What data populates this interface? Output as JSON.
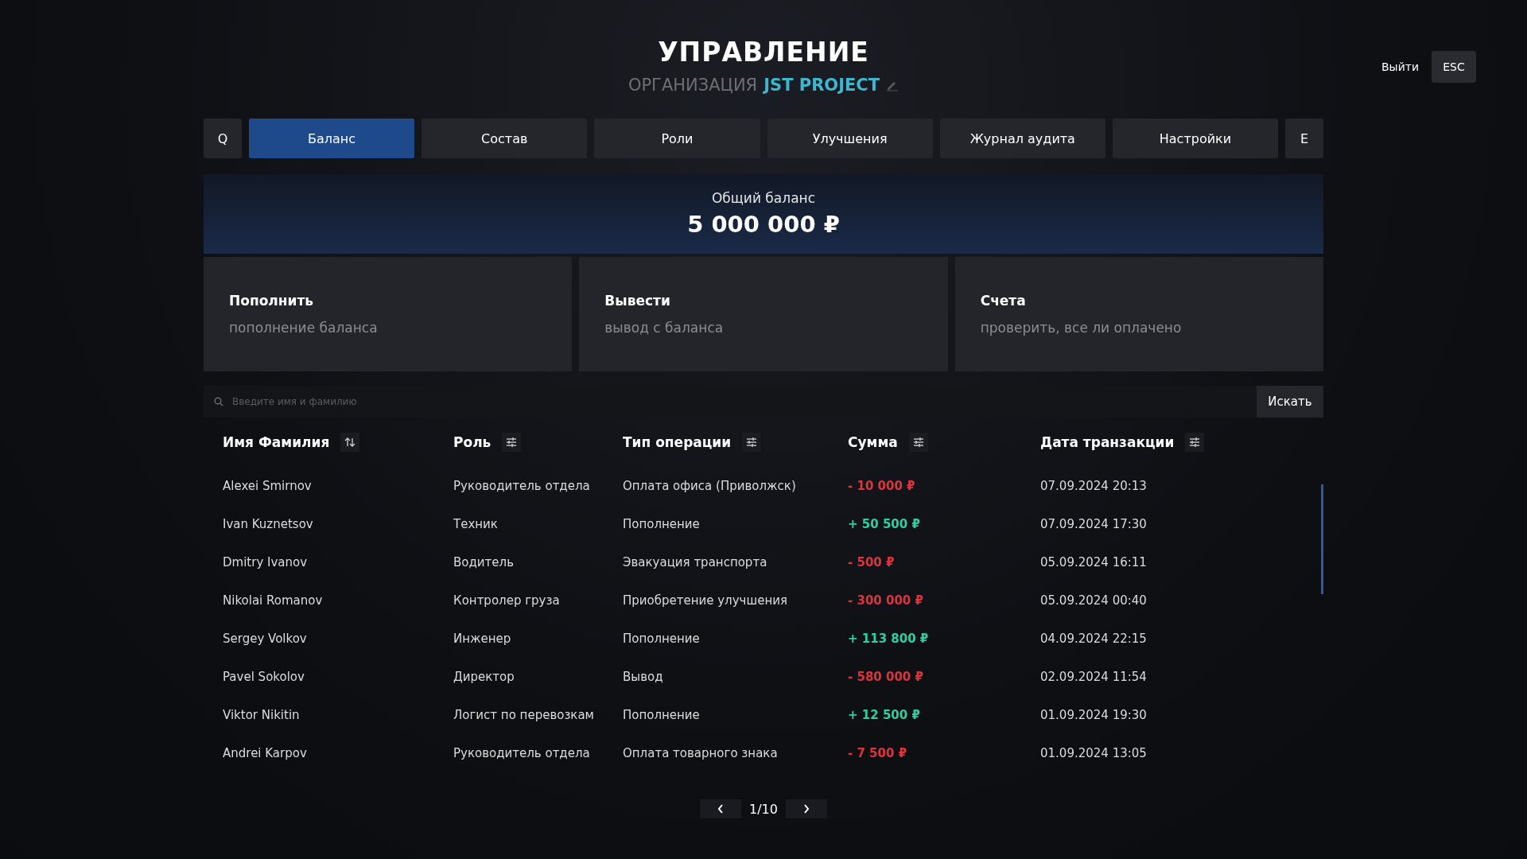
{
  "header": {
    "title": "УПРАВЛЕНИЕ",
    "org_label": "ОРГАНИЗАЦИЯ",
    "org_name": "JST PROJECT"
  },
  "exit": {
    "label": "Выйти",
    "key": "ESC"
  },
  "tabs": [
    {
      "label": "Q",
      "kind": "key",
      "selected": false
    },
    {
      "label": "Баланс",
      "kind": "tab",
      "selected": true
    },
    {
      "label": "Состав",
      "kind": "tab",
      "selected": false
    },
    {
      "label": "Роли",
      "kind": "tab",
      "selected": false
    },
    {
      "label": "Улучшения",
      "kind": "tab",
      "selected": false
    },
    {
      "label": "Журнал аудита",
      "kind": "tab",
      "selected": false
    },
    {
      "label": "Настройки",
      "kind": "tab",
      "selected": false
    },
    {
      "label": "E",
      "kind": "key",
      "selected": false
    }
  ],
  "balance": {
    "label": "Общий баланс",
    "value": "5 000 000 ₽"
  },
  "actions": [
    {
      "title": "Пополнить",
      "subtitle": "пополнение баланса"
    },
    {
      "title": "Вывести",
      "subtitle": "вывод с баланса"
    },
    {
      "title": "Счета",
      "subtitle": "проверить, все ли оплачено"
    }
  ],
  "search": {
    "placeholder": "Введите имя и фамилию",
    "button": "Искать"
  },
  "table": {
    "columns": [
      {
        "label": "Имя Фамилия",
        "kind": "sort"
      },
      {
        "label": "Роль",
        "kind": "filter"
      },
      {
        "label": "Тип операции",
        "kind": "filter"
      },
      {
        "label": "Сумма",
        "kind": "filter"
      },
      {
        "label": "Дата транзакции",
        "kind": "filter"
      }
    ],
    "rows": [
      {
        "name": "Alexei Smirnov",
        "role": "Руководитель отдела",
        "operation": "Оплата офиса (Приволжск)",
        "amount": "- 10 000 ₽",
        "kind": "expense",
        "date": "07.09.2024 20:13"
      },
      {
        "name": "Ivan Kuznetsov",
        "role": "Техник",
        "operation": "Пополнение",
        "amount": "+ 50 500 ₽",
        "kind": "income",
        "date": "07.09.2024 17:30"
      },
      {
        "name": "Dmitry Ivanov",
        "role": "Водитель",
        "operation": "Эвакуация транспорта",
        "amount": "- 500 ₽",
        "kind": "expense",
        "date": "05.09.2024 16:11"
      },
      {
        "name": "Nikolai Romanov",
        "role": "Контролер груза",
        "operation": "Приобретение улучшения",
        "amount": "- 300 000 ₽",
        "kind": "expense",
        "date": "05.09.2024 00:40"
      },
      {
        "name": "Sergey Volkov",
        "role": "Инженер",
        "operation": "Пополнение",
        "amount": "+ 113 800 ₽",
        "kind": "income",
        "date": "04.09.2024 22:15"
      },
      {
        "name": "Pavel Sokolov",
        "role": "Директор",
        "operation": "Вывод",
        "amount": "- 580 000 ₽",
        "kind": "expense",
        "date": "02.09.2024 11:54"
      },
      {
        "name": "Viktor Nikitin",
        "role": "Логист по перевозкам",
        "operation": "Пополнение",
        "amount": "+ 12 500 ₽",
        "kind": "income",
        "date": "01.09.2024 19:30"
      },
      {
        "name": "Andrei Karpov",
        "role": "Руководитель отдела",
        "operation": "Оплата товарного знака",
        "amount": "- 7 500 ₽",
        "kind": "expense",
        "date": "01.09.2024 13:05"
      }
    ]
  },
  "pagination": {
    "page": "1/10"
  }
}
